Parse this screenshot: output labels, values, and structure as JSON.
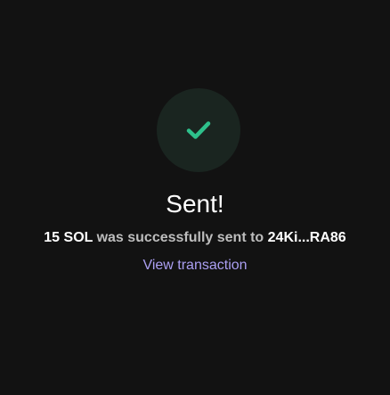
{
  "status": {
    "icon": "checkmark-icon",
    "title": "Sent!",
    "accent_color": "#2ec08b"
  },
  "message": {
    "amount": "15 SOL",
    "middle": " was successfully sent to ",
    "recipient": "24Ki...RA86"
  },
  "link": {
    "label": "View transaction",
    "color": "#ab9ff2"
  }
}
